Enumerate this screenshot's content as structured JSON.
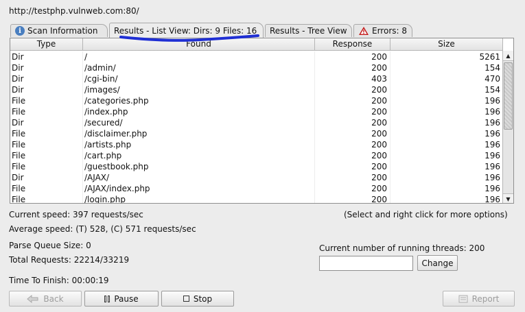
{
  "target_url": "http://testphp.vulnweb.com:80/",
  "tabs": [
    {
      "label": "Scan Information",
      "icon": "info-icon"
    },
    {
      "label": "Results - List View: Dirs: 9 Files: 16",
      "active": true
    },
    {
      "label": "Results - Tree View"
    },
    {
      "label": "Errors: 8",
      "icon": "warning-icon"
    }
  ],
  "table": {
    "columns": [
      "Type",
      "Found",
      "Response",
      "Size"
    ],
    "rows": [
      [
        "Dir",
        "/",
        "200",
        "5261"
      ],
      [
        "Dir",
        "/admin/",
        "200",
        "154"
      ],
      [
        "Dir",
        "/cgi-bin/",
        "403",
        "470"
      ],
      [
        "Dir",
        "/images/",
        "200",
        "154"
      ],
      [
        "File",
        "/categories.php",
        "200",
        "196"
      ],
      [
        "File",
        "/index.php",
        "200",
        "196"
      ],
      [
        "Dir",
        "/secured/",
        "200",
        "196"
      ],
      [
        "File",
        "/disclaimer.php",
        "200",
        "196"
      ],
      [
        "File",
        "/artists.php",
        "200",
        "196"
      ],
      [
        "File",
        "/cart.php",
        "200",
        "196"
      ],
      [
        "File",
        "/guestbook.php",
        "200",
        "196"
      ],
      [
        "Dir",
        "/AJAX/",
        "200",
        "196"
      ],
      [
        "File",
        "/AJAX/index.php",
        "200",
        "196"
      ],
      [
        "File",
        "/login.php",
        "200",
        "196"
      ]
    ]
  },
  "status": {
    "current_speed": "Current speed: 397 requests/sec",
    "average_speed": "Average speed: (T) 528, (C) 571 requests/sec",
    "hint": "(Select and right click for more options)",
    "parse_queue": "Parse Queue Size: 0",
    "total_requests": "Total Requests: 22214/33219",
    "threads_label": "Current number of running threads: 200",
    "threads_value": "",
    "time_to_finish": "Time To Finish: 00:00:19"
  },
  "buttons": {
    "change": "Change",
    "back": "Back",
    "pause": "Pause",
    "stop": "Stop",
    "report": "Report"
  },
  "colors": {
    "annotation": "#1f2fd4",
    "warning": "#c41a1a",
    "info": "#4a7fc0"
  }
}
